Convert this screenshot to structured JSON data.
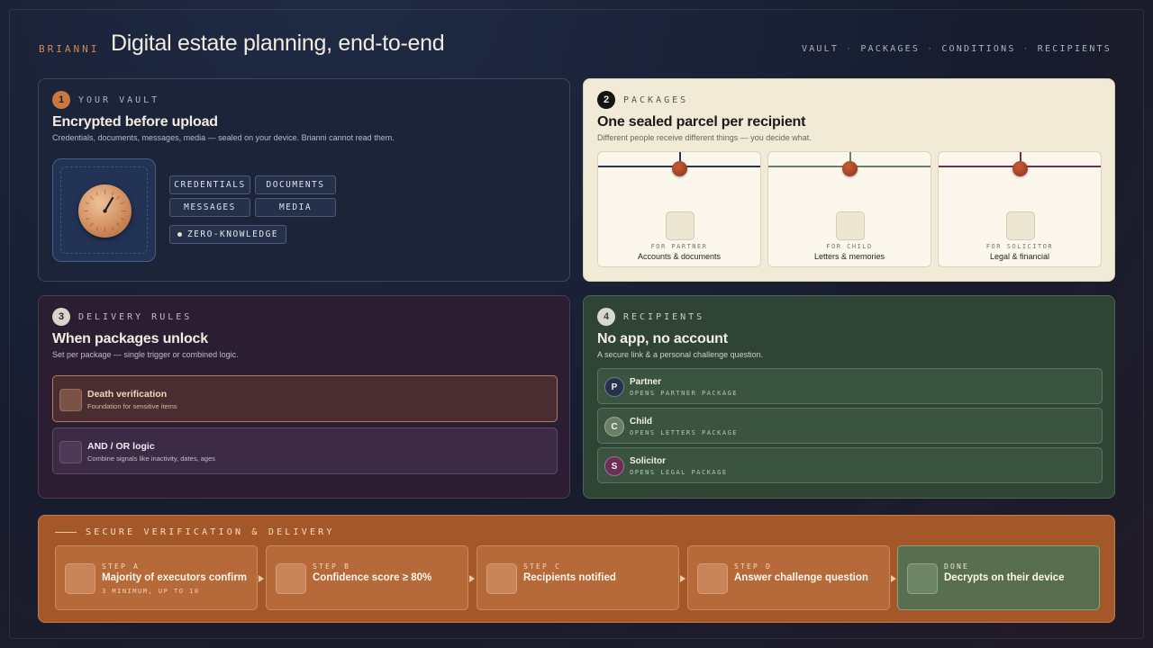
{
  "header": {
    "brand": "BRIANNI",
    "title": "Digital estate planning, end-to-end",
    "nav": [
      "VAULT",
      "PACKAGES",
      "CONDITIONS",
      "RECIPIENTS"
    ],
    "nav_separator": "·"
  },
  "vault": {
    "number": "1",
    "kicker": "YOUR VAULT",
    "title": "Encrypted before upload",
    "subtitle": "Credentials, documents, messages, media — sealed on your device. Brianni cannot read them.",
    "chips": [
      "CREDENTIALS",
      "DOCUMENTS",
      "MESSAGES",
      "MEDIA"
    ],
    "badge": "ZERO-KNOWLEDGE"
  },
  "packages": {
    "number": "2",
    "kicker": "PACKAGES",
    "title": "One sealed parcel per recipient",
    "subtitle": "Different people receive different things — you decide what.",
    "items": [
      {
        "for": "FOR PARTNER",
        "what": "Accounts & documents",
        "ribbon": "#2a3556"
      },
      {
        "for": "FOR CHILD",
        "what": "Letters & memories",
        "ribbon": "#6b7f62"
      },
      {
        "for": "FOR SOLICITOR",
        "what": "Legal & financial",
        "ribbon": "#6e2f52"
      }
    ]
  },
  "rules": {
    "number": "3",
    "kicker": "DELIVERY RULES",
    "title": "When packages unlock",
    "subtitle": "Set per package — single trigger or combined logic.",
    "items": [
      {
        "title": "Death verification",
        "sub": "Foundation for sensitive items"
      },
      {
        "title": "AND / OR logic",
        "sub": "Combine signals like inactivity, dates, ages"
      }
    ]
  },
  "recipients": {
    "number": "4",
    "kicker": "RECIPIENTS",
    "title": "No app, no account",
    "subtitle": "A secure link & a personal challenge question.",
    "items": [
      {
        "initial": "P",
        "name": "Partner",
        "opens": "OPENS PARTNER PACKAGE",
        "color": "#26314f"
      },
      {
        "initial": "C",
        "name": "Child",
        "opens": "OPENS LETTERS PACKAGE",
        "color": "#6a7f64"
      },
      {
        "initial": "S",
        "name": "Solicitor",
        "opens": "OPENS LEGAL PACKAGE",
        "color": "#6b2f55"
      }
    ]
  },
  "strip": {
    "title": "SECURE VERIFICATION & DELIVERY",
    "steps": [
      {
        "label": "STEP A",
        "title": "Majority of executors confirm",
        "note": "3 MINIMUM, UP TO 10"
      },
      {
        "label": "STEP B",
        "title": "Confidence score ≥ 80%",
        "note": ""
      },
      {
        "label": "STEP C",
        "title": "Recipients notified",
        "note": ""
      },
      {
        "label": "STEP D",
        "title": "Answer challenge question",
        "note": ""
      },
      {
        "label": "DONE",
        "title": "Decrypts on their device",
        "note": ""
      }
    ]
  }
}
